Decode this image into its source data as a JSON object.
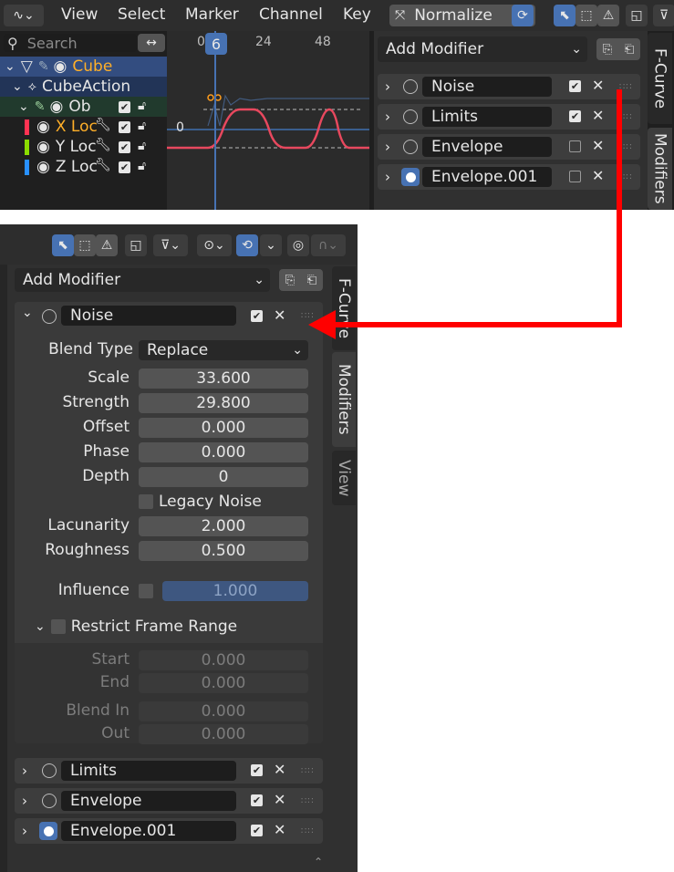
{
  "top": {
    "menu": [
      "View",
      "Select",
      "Marker",
      "Channel",
      "Key"
    ],
    "normalize_label": "Normalize",
    "search_placeholder": "Search",
    "frame_current": "6",
    "frame_ticks": [
      "0",
      "24",
      "48"
    ],
    "zero_label": "0",
    "channels": [
      {
        "label": "Cube"
      },
      {
        "label": "CubeAction"
      },
      {
        "label": "Ob"
      },
      {
        "label": "X Loc"
      },
      {
        "label": "Y Loc"
      },
      {
        "label": "Z Loc"
      }
    ],
    "add_modifier": "Add Modifier",
    "modifiers": [
      {
        "name": "Noise",
        "enabled": true
      },
      {
        "name": "Limits",
        "enabled": true
      },
      {
        "name": "Envelope",
        "enabled": false
      },
      {
        "name": "Envelope.001",
        "enabled": false
      }
    ],
    "tabs": [
      "F-Curve",
      "Modifiers"
    ]
  },
  "bottom": {
    "add_modifier": "Add Modifier",
    "noise": {
      "name": "Noise",
      "blend_type_label": "Blend Type",
      "blend_type_value": "Replace",
      "props": [
        {
          "label": "Scale",
          "value": "33.600"
        },
        {
          "label": "Strength",
          "value": "29.800"
        },
        {
          "label": "Offset",
          "value": "0.000"
        },
        {
          "label": "Phase",
          "value": "0.000"
        },
        {
          "label": "Depth",
          "value": "0"
        }
      ],
      "legacy_noise": "Legacy Noise",
      "props2": [
        {
          "label": "Lacunarity",
          "value": "2.000"
        },
        {
          "label": "Roughness",
          "value": "0.500"
        }
      ],
      "influence_label": "Influence",
      "influence_value": "1.000",
      "restrict_label": "Restrict Frame Range",
      "restrict_props": [
        {
          "label": "Start",
          "value": "0.000"
        },
        {
          "label": "End",
          "value": "0.000"
        },
        {
          "label": "Blend In",
          "value": "0.000"
        },
        {
          "label": "Out",
          "value": "0.000"
        }
      ]
    },
    "modifiers": [
      {
        "name": "Limits",
        "enabled": true
      },
      {
        "name": "Envelope",
        "enabled": true
      },
      {
        "name": "Envelope.001",
        "enabled": true
      }
    ],
    "tabs": [
      "F-Curve",
      "Modifiers",
      "View"
    ]
  },
  "colors": {
    "accent": "#4772b3",
    "arrow": "#ff0000",
    "curve": "#e8485e"
  }
}
